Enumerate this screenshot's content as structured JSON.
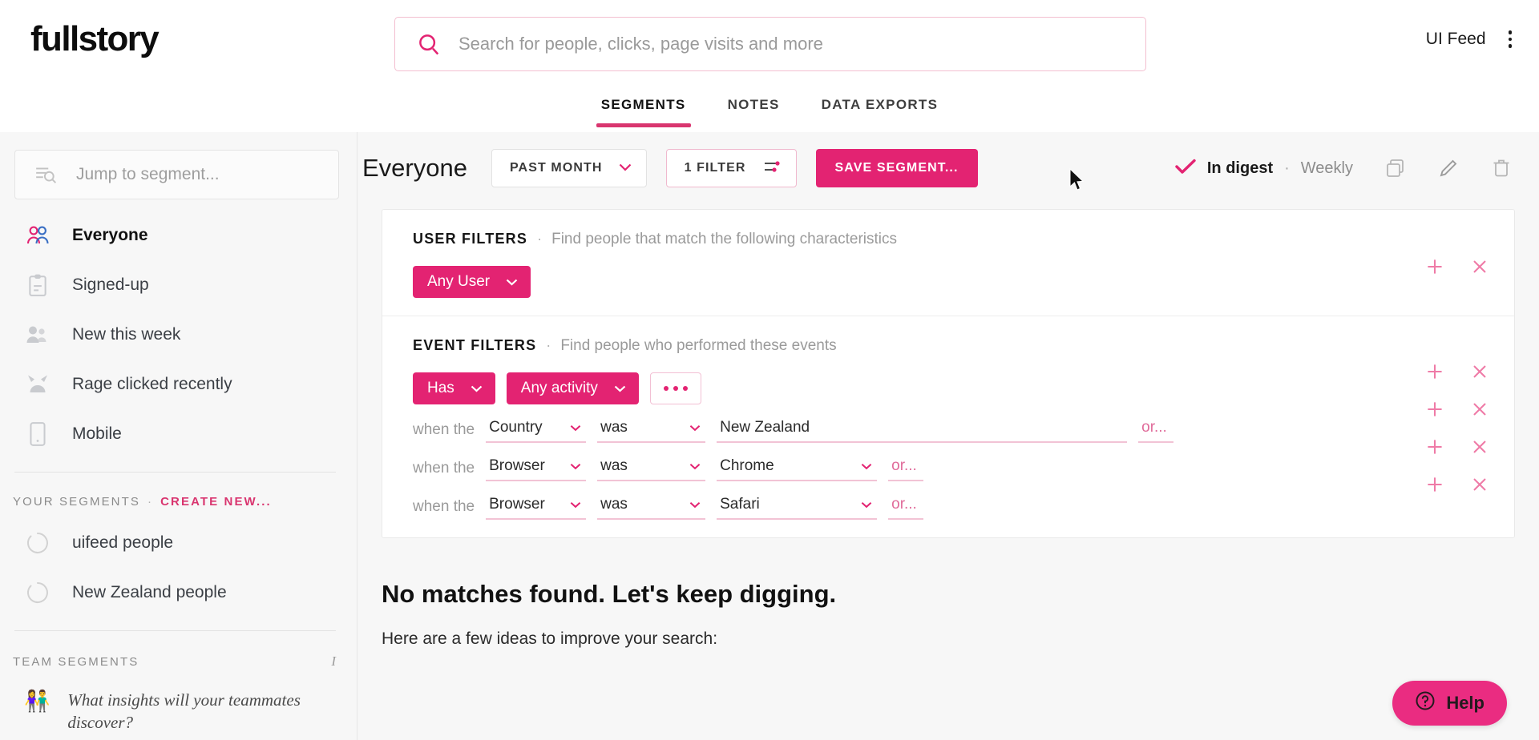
{
  "header": {
    "logo": "fullstory",
    "search": {
      "value": "",
      "placeholder": "Search for people, clicks, page visits and more"
    },
    "account_name": "UI Feed",
    "tabs": [
      {
        "label": "SEGMENTS",
        "active": true
      },
      {
        "label": "NOTES",
        "active": false
      },
      {
        "label": "DATA EXPORTS",
        "active": false
      }
    ]
  },
  "sidebar": {
    "jump_placeholder": "Jump to segment...",
    "jump_value": "",
    "items": [
      {
        "label": "Everyone",
        "icon": "people-icon",
        "active": true
      },
      {
        "label": "Signed-up",
        "icon": "clipboard-icon",
        "active": false
      },
      {
        "label": "New this week",
        "icon": "new-person-icon",
        "active": false
      },
      {
        "label": "Rage clicked recently",
        "icon": "rage-click-icon",
        "active": false
      },
      {
        "label": "Mobile",
        "icon": "mobile-icon",
        "active": false
      }
    ],
    "your_segments": {
      "title": "YOUR SEGMENTS",
      "separator": "·",
      "create_new": "CREATE NEW...",
      "items": [
        {
          "label": "uifeed people",
          "icon": "spinner-icon"
        },
        {
          "label": "New Zealand people",
          "icon": "spinner-icon"
        }
      ]
    },
    "team_segments": {
      "title": "TEAM SEGMENTS",
      "info": "i",
      "items": [
        {
          "emoji": "👫",
          "label": "What insights will your teammates discover?"
        }
      ]
    }
  },
  "toolbar": {
    "segment_title": "Everyone",
    "date_range": "PAST MONTH",
    "filter_count": "1 FILTER",
    "save_segment": "SAVE SEGMENT...",
    "digest_label": "In digest",
    "digest_sep": "·",
    "digest_frequency": "Weekly",
    "icons": [
      "copy-icon",
      "pencil-icon",
      "trash-icon"
    ]
  },
  "filters": {
    "user": {
      "title": "USER FILTERS",
      "separator": "·",
      "description": "Find people that match the following characteristics",
      "pill": "Any User"
    },
    "event": {
      "title": "EVENT FILTERS",
      "separator": "·",
      "description": "Find people who performed these events",
      "pills": [
        "Has",
        "Any activity"
      ],
      "more_label": "•••",
      "rows": [
        {
          "prefix": "when the",
          "attribute": "Country",
          "operator": "was",
          "value": "New Zealand",
          "or_label": "or...",
          "wide": true
        },
        {
          "prefix": "when the",
          "attribute": "Browser",
          "operator": "was",
          "value": "Chrome",
          "or_label": "or...",
          "wide": false
        },
        {
          "prefix": "when the",
          "attribute": "Browser",
          "operator": "was",
          "value": "Safari",
          "or_label": "or...",
          "wide": false
        }
      ]
    }
  },
  "empty_state": {
    "heading": "No matches found. Let's keep digging.",
    "subtext": "Here are a few ideas to improve your search:"
  },
  "help": {
    "label": "Help"
  },
  "colors": {
    "accent": "#e32372",
    "accent_light": "#f2c3d5",
    "help_bg": "#ea2c81",
    "sidebar_bg": "#f7f7f7"
  }
}
